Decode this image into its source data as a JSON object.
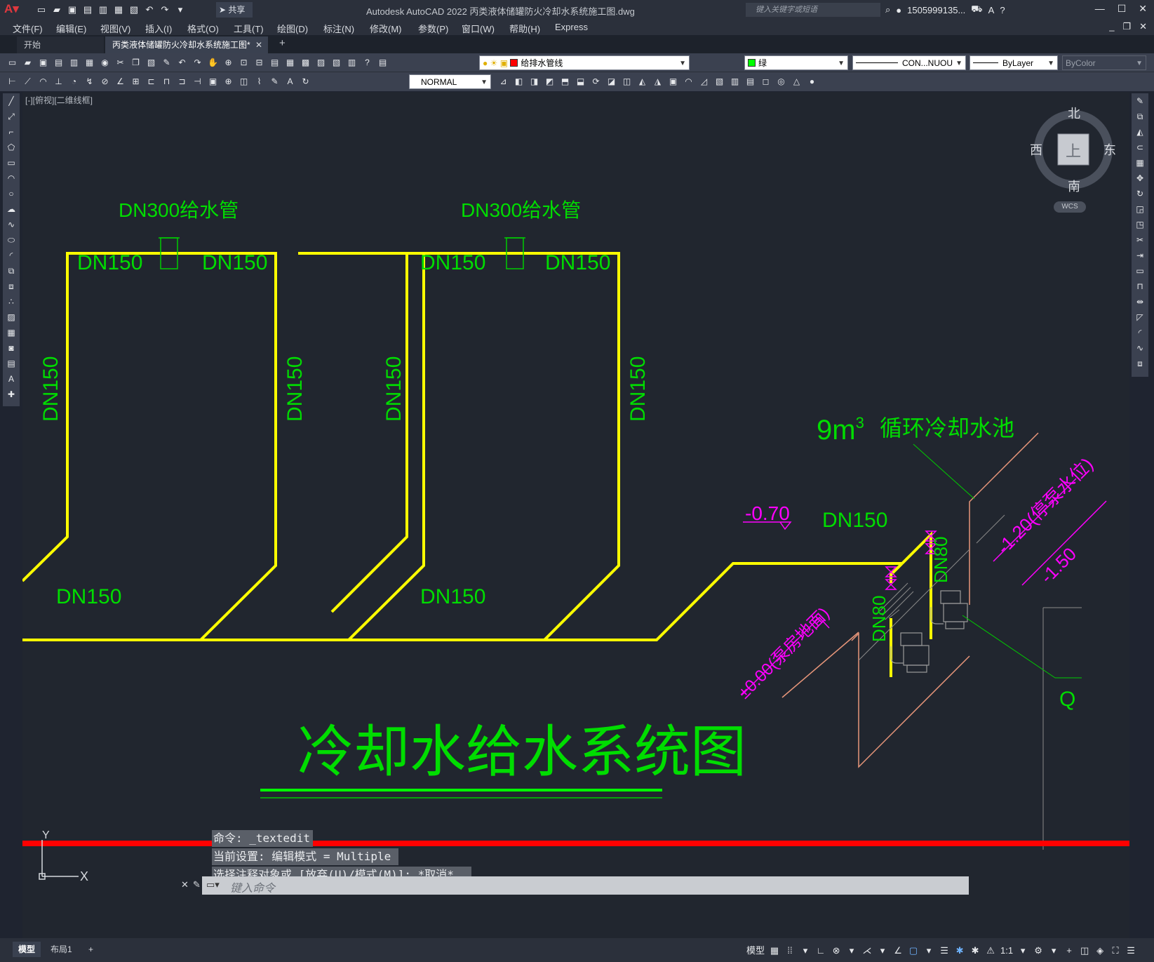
{
  "window": {
    "title": "Autodesk AutoCAD 2022    丙类液体储罐防火冷却水系统施工图.dwg",
    "share_label": "共享",
    "search_placeholder": "键入关键字或短语",
    "user": "1505999135..."
  },
  "menu": [
    "文件(F)",
    "编辑(E)",
    "视图(V)",
    "插入(I)",
    "格式(O)",
    "工具(T)",
    "绘图(D)",
    "标注(N)",
    "修改(M)",
    "参数(P)",
    "窗口(W)",
    "帮助(H)",
    "Express"
  ],
  "tabs": {
    "start": "开始",
    "document": "丙类液体储罐防火冷却水系统施工图*"
  },
  "toolbar": {
    "layer": "给排水管线",
    "layer_color": "#ff0000",
    "color": "绿",
    "color_swatch": "#00ff00",
    "linetype": "CON...NUOU",
    "lineweight": "ByLayer",
    "plotstyle": "ByColor",
    "dimstyle": "NORMAL"
  },
  "view": {
    "label": "[-][俯视][二维线框]",
    "compass": {
      "n": "北",
      "s": "南",
      "e": "东",
      "w": "西",
      "top": "上",
      "wcs": "WCS"
    }
  },
  "drawing": {
    "pipe_color": "#ffff00",
    "text_color": "#00dd00",
    "magenta": "#ff00ff",
    "supply1": "DN300给水管",
    "supply2": "DN300给水管",
    "dn150": "DN150",
    "dn80": "DN80",
    "level_neg070": "-0.70",
    "level_top": "-1.20(停泵水位)",
    "level_bottom": "-1.50",
    "level_ground": "±0.00(泵房地面)",
    "pool": "9m³ 循环冷却水池",
    "pool_num": "9m",
    "pool_sup": "3",
    "pool_name": "循环冷却水池",
    "q_label": "Q",
    "diagram_title": "冷却水给水系统图",
    "ucs_x": "X",
    "ucs_y": "Y"
  },
  "command": {
    "history": [
      "命令: _textedit",
      "当前设置: 编辑模式 = Multiple",
      "选择注释对象或 [放弃(U)/模式(M)]: *取消*"
    ],
    "placeholder": "键入命令"
  },
  "status": {
    "model_tab": "模型",
    "layout_tab": "布局1",
    "model_btn": "模型",
    "scale": "1:1"
  }
}
